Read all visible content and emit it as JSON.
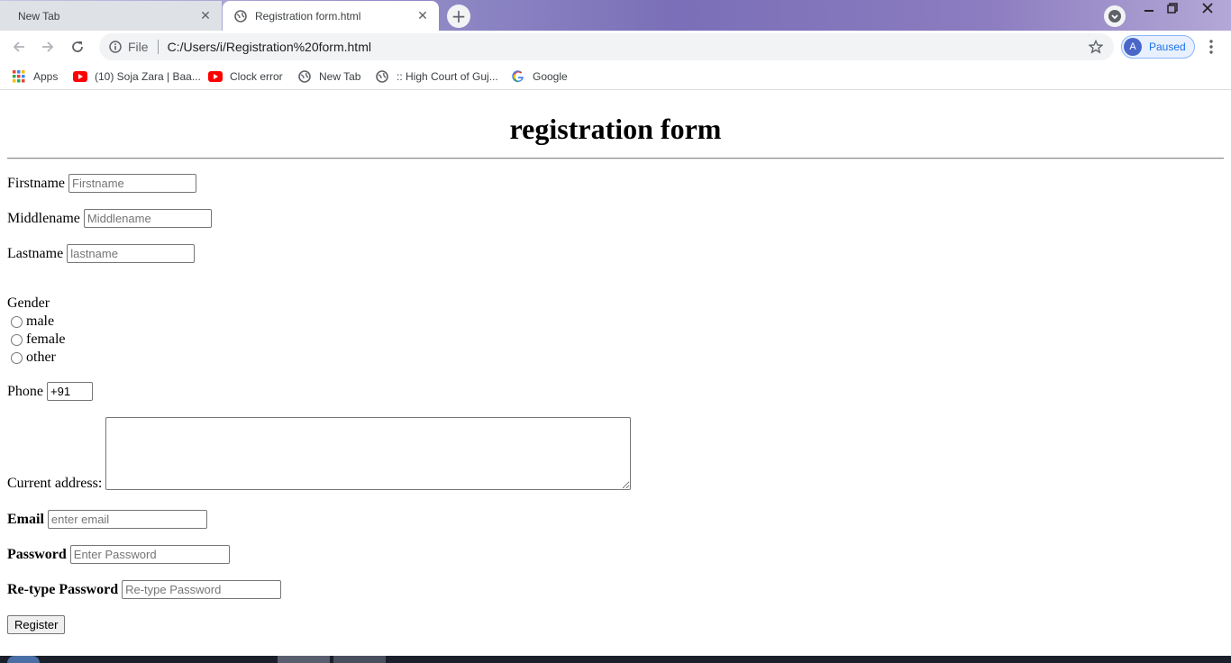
{
  "browser": {
    "tabs": [
      {
        "title": "New Tab",
        "active": false
      },
      {
        "title": "Registration form.html",
        "active": true
      }
    ],
    "address_bar": {
      "scheme_label": "File",
      "url": "C:/Users/i/Registration%20form.html"
    },
    "profile": {
      "initial": "A",
      "status": "Paused"
    },
    "bookmarks": [
      {
        "label": "Apps",
        "icon": "apps-grid-icon"
      },
      {
        "label": "(10) Soja Zara | Baa...",
        "icon": "youtube-icon"
      },
      {
        "label": "Clock error",
        "icon": "youtube-icon"
      },
      {
        "label": "New Tab",
        "icon": "globe-icon"
      },
      {
        "label": ":: High Court of Guj...",
        "icon": "globe-icon"
      },
      {
        "label": "Google",
        "icon": "google-icon"
      }
    ]
  },
  "form": {
    "heading": "registration form",
    "firstname": {
      "label": "Firstname",
      "placeholder": "Firstname"
    },
    "middlename": {
      "label": "Middlename",
      "placeholder": "Middlename"
    },
    "lastname": {
      "label": "Lastname",
      "placeholder": "lastname"
    },
    "gender": {
      "label": "Gender",
      "options": [
        "male",
        "female",
        "other"
      ]
    },
    "phone": {
      "label": "Phone",
      "value": "+91"
    },
    "address": {
      "label": "Current address:"
    },
    "email": {
      "label": "Email",
      "placeholder": "enter email"
    },
    "password": {
      "label": "Password",
      "placeholder": "Enter Password"
    },
    "retype_password": {
      "label": "Re-type Password",
      "placeholder": "Re-type Password"
    },
    "submit_label": "Register"
  },
  "colors": {
    "accent": "#1a73e8",
    "youtube_red": "#ff0000",
    "tab_inactive": "#dee1e6",
    "omnibox_bg": "#f1f3f4"
  }
}
